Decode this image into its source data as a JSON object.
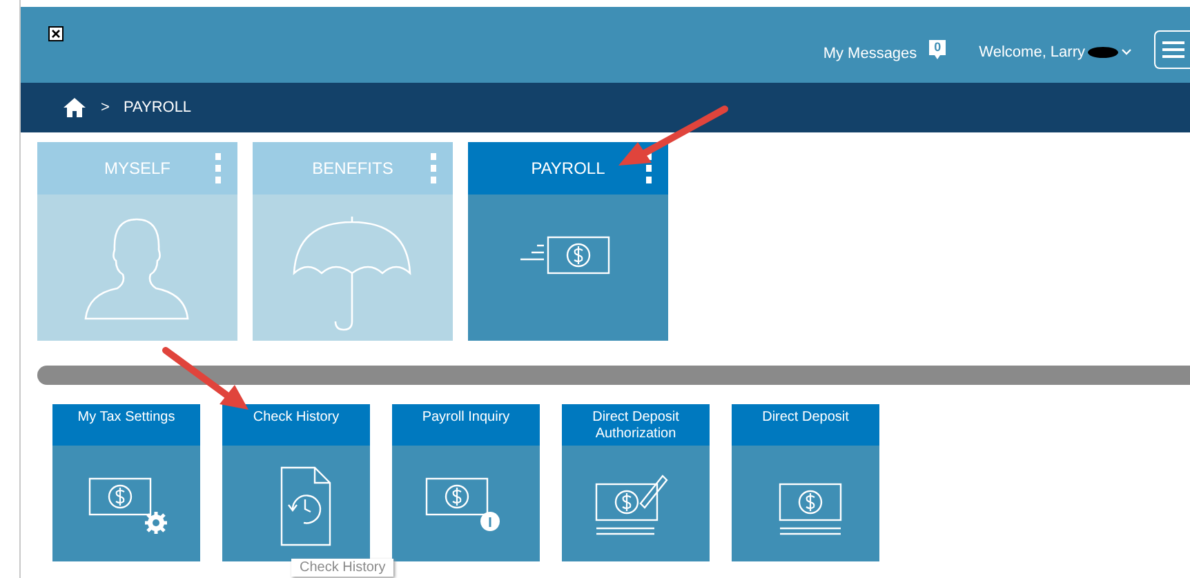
{
  "header": {
    "messages_label": "My Messages",
    "messages_count": "0",
    "welcome": "Welcome, Larry"
  },
  "breadcrumb": {
    "current": "PAYROLL",
    "separator": ">"
  },
  "categories": [
    {
      "label": "MYSELF",
      "selected": false
    },
    {
      "label": "BENEFITS",
      "selected": false
    },
    {
      "label": "PAYROLL",
      "selected": true
    }
  ],
  "tiles": [
    {
      "label": "My Tax Settings"
    },
    {
      "label": "Check History"
    },
    {
      "label": "Payroll Inquiry"
    },
    {
      "label": "Direct Deposit Authorization"
    },
    {
      "label": "Direct Deposit"
    }
  ],
  "tooltip": "Check History"
}
